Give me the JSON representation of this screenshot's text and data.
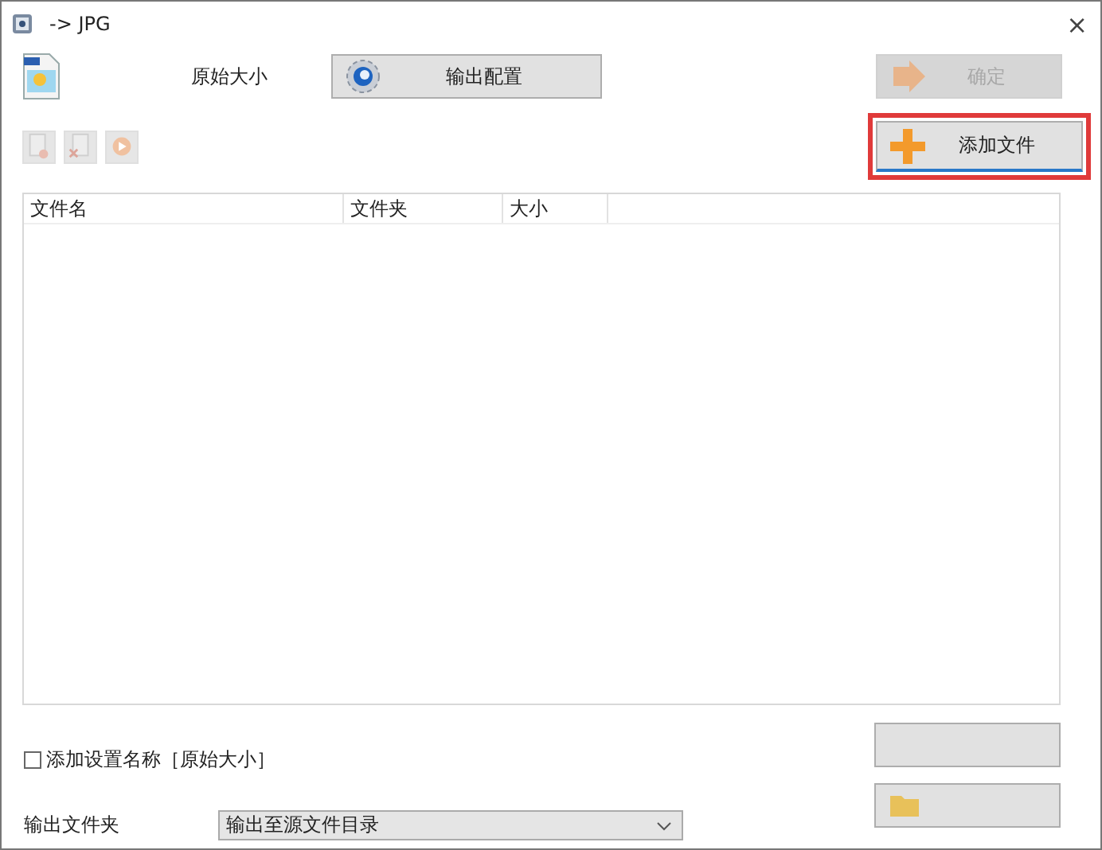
{
  "window": {
    "title": "-> JPG",
    "close": "×"
  },
  "preset": {
    "label": "原始大小"
  },
  "buttons": {
    "config": {
      "label": "输出配置",
      "disabled": false
    },
    "ok": {
      "label": "确定",
      "disabled": true
    },
    "add": {
      "label": "添加文件",
      "disabled": false,
      "highlighted": true
    }
  },
  "toolbar": [
    {
      "kind": "remove",
      "disabled": true
    },
    {
      "kind": "clear",
      "disabled": true
    },
    {
      "kind": "start",
      "disabled": true
    }
  ],
  "table": {
    "columns": [
      "文件名",
      "文件夹",
      "大小"
    ]
  },
  "options": {
    "name_suffix": {
      "label": "添加设置名称［原始大小］",
      "checked": false
    }
  },
  "output": {
    "label": "输出文件夹",
    "value": "输出至源文件目录"
  }
}
